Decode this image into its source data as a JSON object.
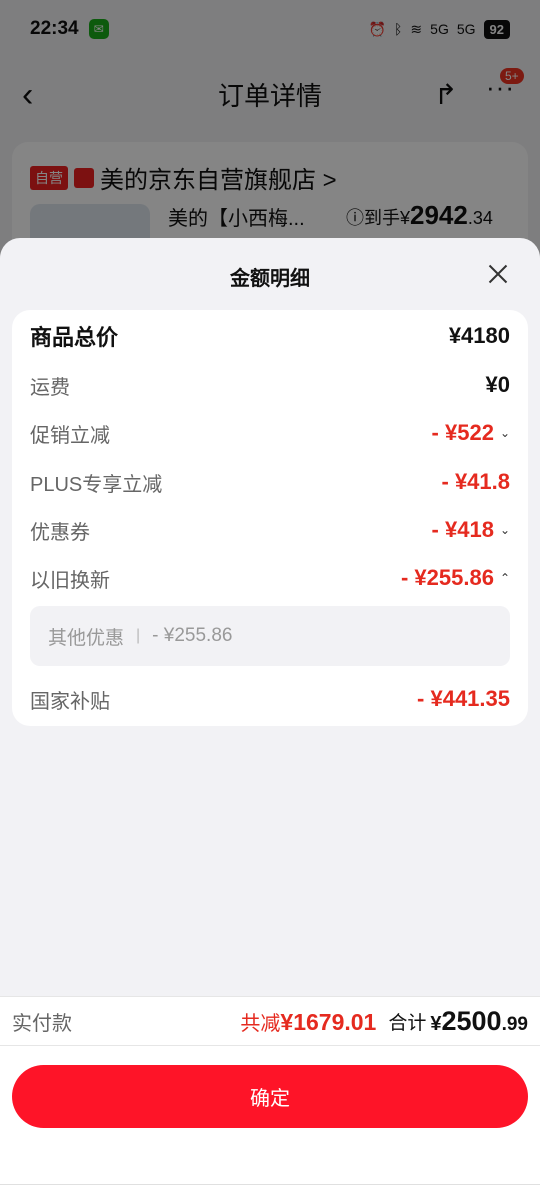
{
  "status_bar": {
    "time": "22:34",
    "battery": "92",
    "signal1": "5G",
    "signal2": "5G"
  },
  "nav": {
    "title": "订单详情",
    "back_icon": "‹",
    "share_icon": "↱",
    "more_icon": "···",
    "badge": "5+"
  },
  "store": {
    "self_tag": "自营",
    "name": "美的京东自营旗舰店 >",
    "product_name": "美的【小西梅...",
    "price_prefix": "ⓘ到手¥",
    "price_int": "2942",
    "price_dec": ".34"
  },
  "sheet": {
    "title": "金额明细",
    "rows": [
      {
        "label": "商品总价",
        "value": "¥4180"
      },
      {
        "label": "运费",
        "value": "¥0"
      },
      {
        "label": "促销立减",
        "value": "- ¥522",
        "chevron": "⌄"
      },
      {
        "label": "PLUS专享立减",
        "value": "- ¥41.8"
      },
      {
        "label": "优惠券",
        "value": "- ¥418",
        "chevron": "⌄"
      },
      {
        "label": "以旧换新",
        "value": "- ¥255.86",
        "chevron": "⌃"
      },
      {
        "label": "国家补贴",
        "value": "- ¥441.35"
      }
    ],
    "sub_item": {
      "label": "其他优惠",
      "separator": "|",
      "value": "- ¥255.86"
    }
  },
  "footer": {
    "pay_label": "实付款",
    "saved_prefix": "共减",
    "saved_value": "¥1679.01",
    "sum_label": "合计",
    "sum_currency": "¥",
    "sum_int": "2500",
    "sum_dec": ".99",
    "confirm_label": "确定"
  },
  "colors": {
    "accent": "#fe1428",
    "discount": "#e52a1f"
  }
}
